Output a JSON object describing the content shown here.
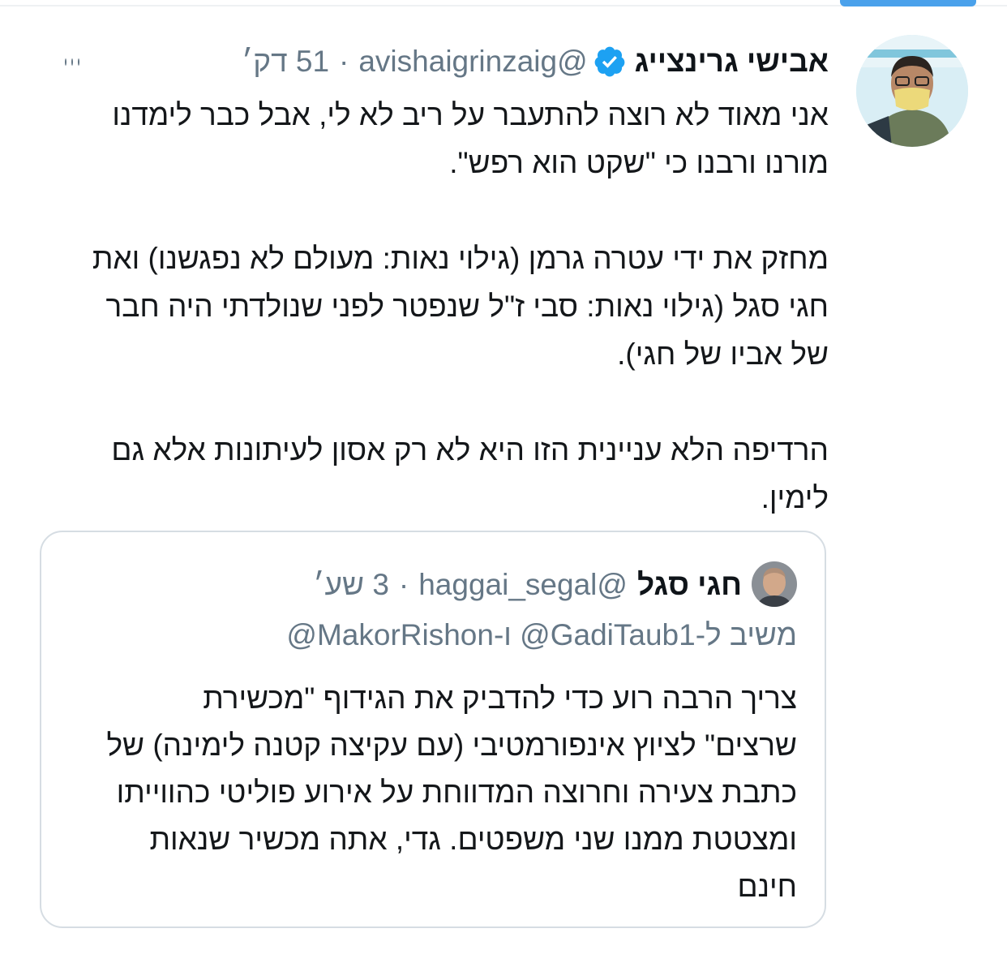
{
  "tweet": {
    "author_name": "אבישי גרינצייג",
    "handle": "@avishaigrinzaig",
    "separator": "·",
    "time": "51 דק׳",
    "body": "אני מאוד לא רוצה להתעבר על ריב לא לי, אבל כבר לימדנו\nמורנו ורבנו כי \"שקט הוא רפש\".\n\nמחזק את ידי עטרה גרמן (גילוי נאות: מעולם לא נפגשנו) ואת\nחגי סגל (גילוי נאות: סבי ז\"ל שנפטר לפני שנולדתי היה חבר\nשל אביו של חגי).\n\nהרדיפה הלא עניינית הזו היא לא רק אסון לעיתונות אלא גם\nלימין.",
    "avatar_icon": "profile-photo",
    "verified_icon": "verified-badge-icon",
    "more_icon": "more-options-icon"
  },
  "quoted": {
    "author_name": "חגי סגל",
    "handle": "@haggai_segal",
    "separator": "·",
    "time": "3 שע׳",
    "reply_to": "משיב ל-GadiTaub1@ ו-MakorRishon@",
    "body": "צריך הרבה רוע כדי להדביק את הגידוף \"מכשירת\nשרצים\" לציוץ אינפורמטיבי (עם עקיצה קטנה לימינה) של\nכתבת צעירה וחרוצה המדווחת על אירוע פוליטי כהווייתו\nומצטטת ממנו שני משפטים. גדי, אתה מכשיר שנאות\nחינם",
    "avatar_icon": "profile-photo"
  },
  "colors": {
    "accent": "#1da1f2",
    "secondary_text": "#657786",
    "border": "#d6dde3"
  }
}
